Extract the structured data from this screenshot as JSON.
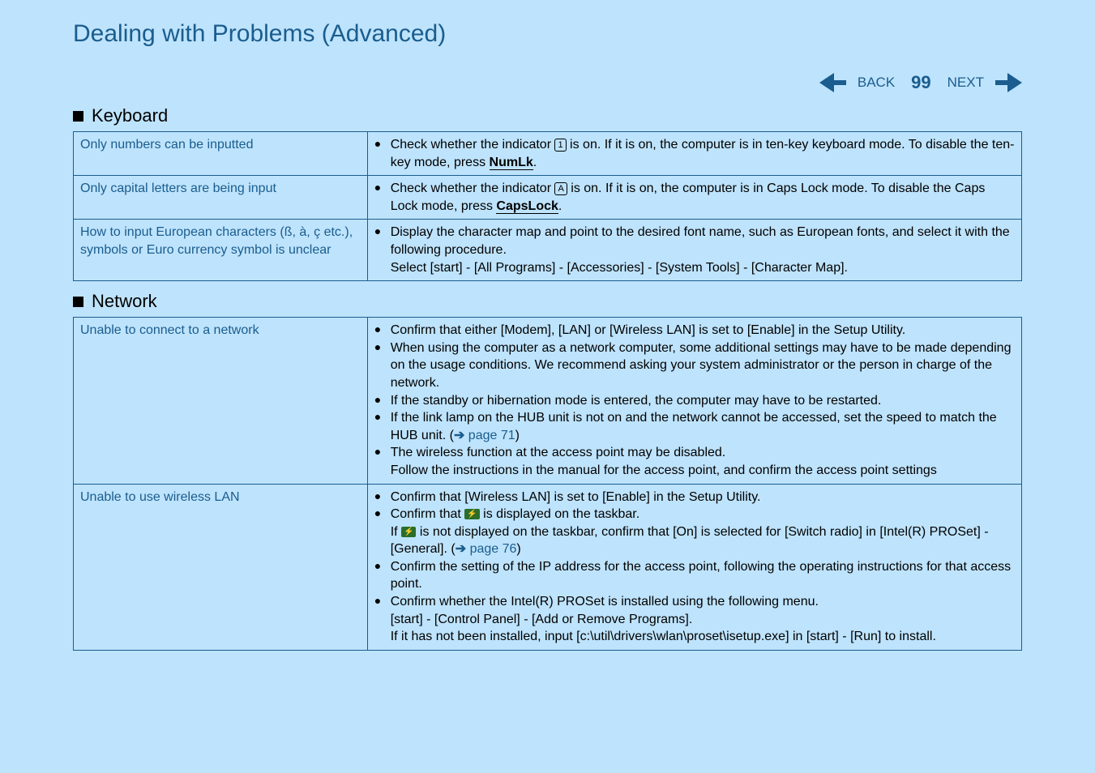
{
  "title": "Dealing with Problems (Advanced)",
  "nav": {
    "back": "BACK",
    "next": "NEXT",
    "page": "99"
  },
  "sections": {
    "keyboard": {
      "heading": "Keyboard",
      "row1": {
        "problem": "Only numbers can be inputted",
        "item1a": "Check whether the indicator ",
        "item1icon": "1",
        "item1b": " is on.  If it is on, the computer is in ten-key keyboard mode.  To disable the ten-key mode, press ",
        "item1key": "NumLk",
        "item1c": "."
      },
      "row2": {
        "problem": "Only capital letters are being input",
        "item1a": "Check whether the indicator ",
        "item1icon": "A",
        "item1b": " is on.  If it is on, the computer is in Caps Lock mode.  To disable the Caps Lock mode, press ",
        "item1key": "CapsLock",
        "item1c": "."
      },
      "row3": {
        "problem": "How to input European characters (ß, à, ç etc.), symbols or Euro currency symbol is unclear",
        "item1": "Display the character map and point to the desired font name, such as European fonts, and select it with the following procedure.",
        "item1b": "Select [start] - [All Programs] - [Accessories] - [System Tools] - [Character Map]."
      }
    },
    "network": {
      "heading": "Network",
      "row1": {
        "problem": "Unable to connect to a network",
        "i1": "Confirm that either [Modem], [LAN] or [Wireless LAN] is set to [Enable] in the Setup Utility.",
        "i2": "When using the computer as a network computer, some additional settings may have to be made depending on the usage conditions.   We recommend asking your system administrator or the person in charge of the network.",
        "i3": "If the standby or hibernation mode is entered, the computer may have to be restarted.",
        "i4a": "If the link lamp on the HUB unit is not on and the network cannot be accessed, set the speed to match the HUB unit. (",
        "i4link": "page 71",
        "i4b": ")",
        "i5": "The wireless function at the access point may be disabled.",
        "i5b": "Follow the instructions in the manual for the access point, and confirm the access point settings"
      },
      "row2": {
        "problem": "Unable to use wireless LAN",
        "i1": "Confirm that [Wireless LAN] is set to [Enable] in the Setup Utility.",
        "i2a": "Confirm that ",
        "i2b": " is displayed on the taskbar.",
        "i2c": "If ",
        "i2d": " is not displayed on the taskbar, confirm that [On] is selected for [Switch radio] in [Intel(R) PROSet] - [General]. (",
        "i2link": "page 76",
        "i2e": ")",
        "i3": "Confirm the setting of the IP address for the access point, following the operating instructions for that access point.",
        "i4": "Confirm whether the Intel(R) PROSet is installed using the following menu.",
        "i4b": "[start] - [Control Panel] - [Add or Remove Programs].",
        "i4c": "If it has not been installed, input [c:\\util\\drivers\\wlan\\proset\\isetup.exe] in [start] - [Run] to install."
      }
    }
  }
}
